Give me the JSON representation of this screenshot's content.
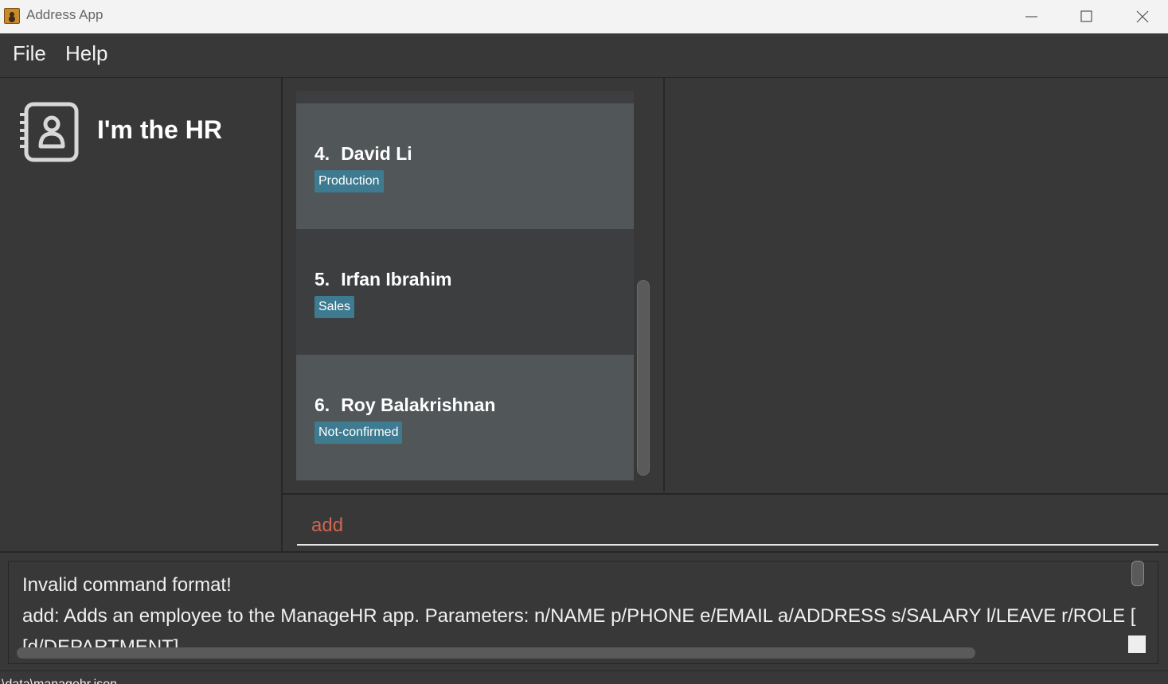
{
  "window": {
    "title": "Address App",
    "controls": [
      "minimize",
      "maximize",
      "close"
    ]
  },
  "menu": {
    "items": [
      "File",
      "Help"
    ]
  },
  "sidebar": {
    "icon": "address-book-icon",
    "heading": "I'm the HR"
  },
  "person_list": {
    "cards": [
      {
        "index": "4.",
        "name": "David Li",
        "tag": "Production"
      },
      {
        "index": "5.",
        "name": "Irfan Ibrahim",
        "tag": "Sales"
      },
      {
        "index": "6.",
        "name": "Roy Balakrishnan",
        "tag": "Not-confirmed"
      }
    ]
  },
  "command": {
    "value": "add"
  },
  "result": {
    "line1": "Invalid command format!",
    "line2": "add: Adds an employee to the ManageHR app. Parameters: n/NAME p/PHONE e/EMAIL a/ADDRESS s/SALARY l/LEAVE r/ROLE [",
    "line3": "[d/DEPARTMENT]"
  },
  "status": {
    "text": "\\data\\managehr.json"
  },
  "colors": {
    "background": "#383838",
    "card_odd": "#515658",
    "card_even": "#3c3e3f",
    "tag": "#3e7b91",
    "command_text": "#d06651"
  }
}
